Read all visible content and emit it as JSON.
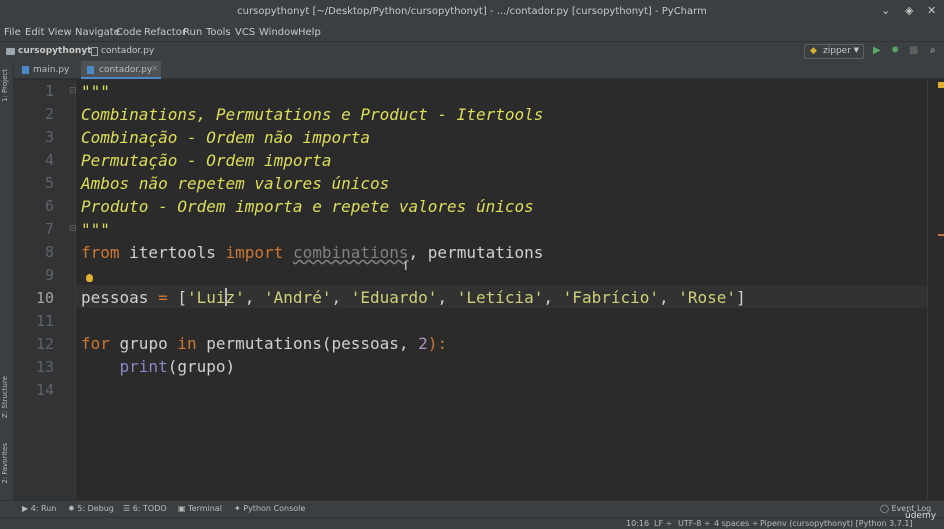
{
  "window": {
    "title": "cursopythonyt [~/Desktop/Python/cursopythonyt] - .../contador.py [cursopythonyt] - PyCharm",
    "controls": [
      "chevron-down-icon",
      "restore-icon",
      "close-icon"
    ]
  },
  "menu": [
    "File",
    "Edit",
    "View",
    "Navigate",
    "Code",
    "Refactor",
    "Run",
    "Tools",
    "VCS",
    "Window",
    "Help"
  ],
  "nav": {
    "project": "cursopythonyt",
    "file": "contador.py",
    "run_config": "zipper"
  },
  "tabs": [
    {
      "label": "main.py",
      "active": false
    },
    {
      "label": "contador.py",
      "active": true
    }
  ],
  "side_tabs": {
    "project": "1: Project",
    "structure": "Z: Structure",
    "favorites": "2: Favorites"
  },
  "code": {
    "line_numbers": [
      "1",
      "2",
      "3",
      "4",
      "5",
      "6",
      "7",
      "8",
      "9",
      "10",
      "11",
      "12",
      "13",
      "14"
    ],
    "current_line": 10,
    "lines": {
      "l1": "\"\"\"",
      "l2": "Combinations, Permutations e Product - Itertools",
      "l3": "Combinação - Ordem não importa",
      "l4": "Permutação - Ordem importa",
      "l5": "Ambos não repetem valores únicos",
      "l6": "Produto - Ordem importa e repete valores únicos",
      "l7": "\"\"\"",
      "l8": {
        "kw_from": "from",
        "module": " itertools ",
        "kw_import": "import",
        "unused": "combinations",
        "rest": ", permutations"
      },
      "l10": {
        "var": "pessoas ",
        "op": "= ",
        "open": "[",
        "s1a": "'Lui",
        "s1b": "z'",
        "c1": ", ",
        "s2": "'André'",
        "c2": ", ",
        "s3": "'Eduardo'",
        "c3": ", ",
        "s4": "'Letícia'",
        "c4": ", ",
        "s5": "'Fabrício'",
        "c5": ", ",
        "s6": "'Rose'",
        "close": "]"
      },
      "l12": {
        "kw_for": "for",
        "var": " grupo ",
        "kw_in": "in",
        "call": " permutations(pessoas, ",
        "num": "2",
        "end": "):"
      },
      "l13": {
        "indent": "    ",
        "fn": "print",
        "args": "(grupo)"
      }
    }
  },
  "tool_windows": [
    {
      "label": "4: Run",
      "icon": "run-icon"
    },
    {
      "label": "5: Debug",
      "icon": "debug-icon"
    },
    {
      "label": "6: TODO",
      "icon": "todo-icon"
    },
    {
      "label": "Terminal",
      "icon": "terminal-icon"
    },
    {
      "label": "Python Console",
      "icon": "python-icon"
    }
  ],
  "event_log": "Event Log",
  "status": {
    "position": "10:16",
    "line_sep": "LF ÷",
    "encoding": "UTF-8 ÷",
    "indent": "4 spaces ÷",
    "interpreter": "Pipenv (cursopythonyt) [Python 3.7.1]"
  },
  "watermark": "ûdemy",
  "colors": {
    "bg": "#2b2b2b",
    "panel": "#3c3f41",
    "docstring": "#dede5a",
    "keyword": "#cc7832",
    "string": "#d0d07a",
    "number": "#6897bb",
    "accent": "#4a88c7"
  }
}
